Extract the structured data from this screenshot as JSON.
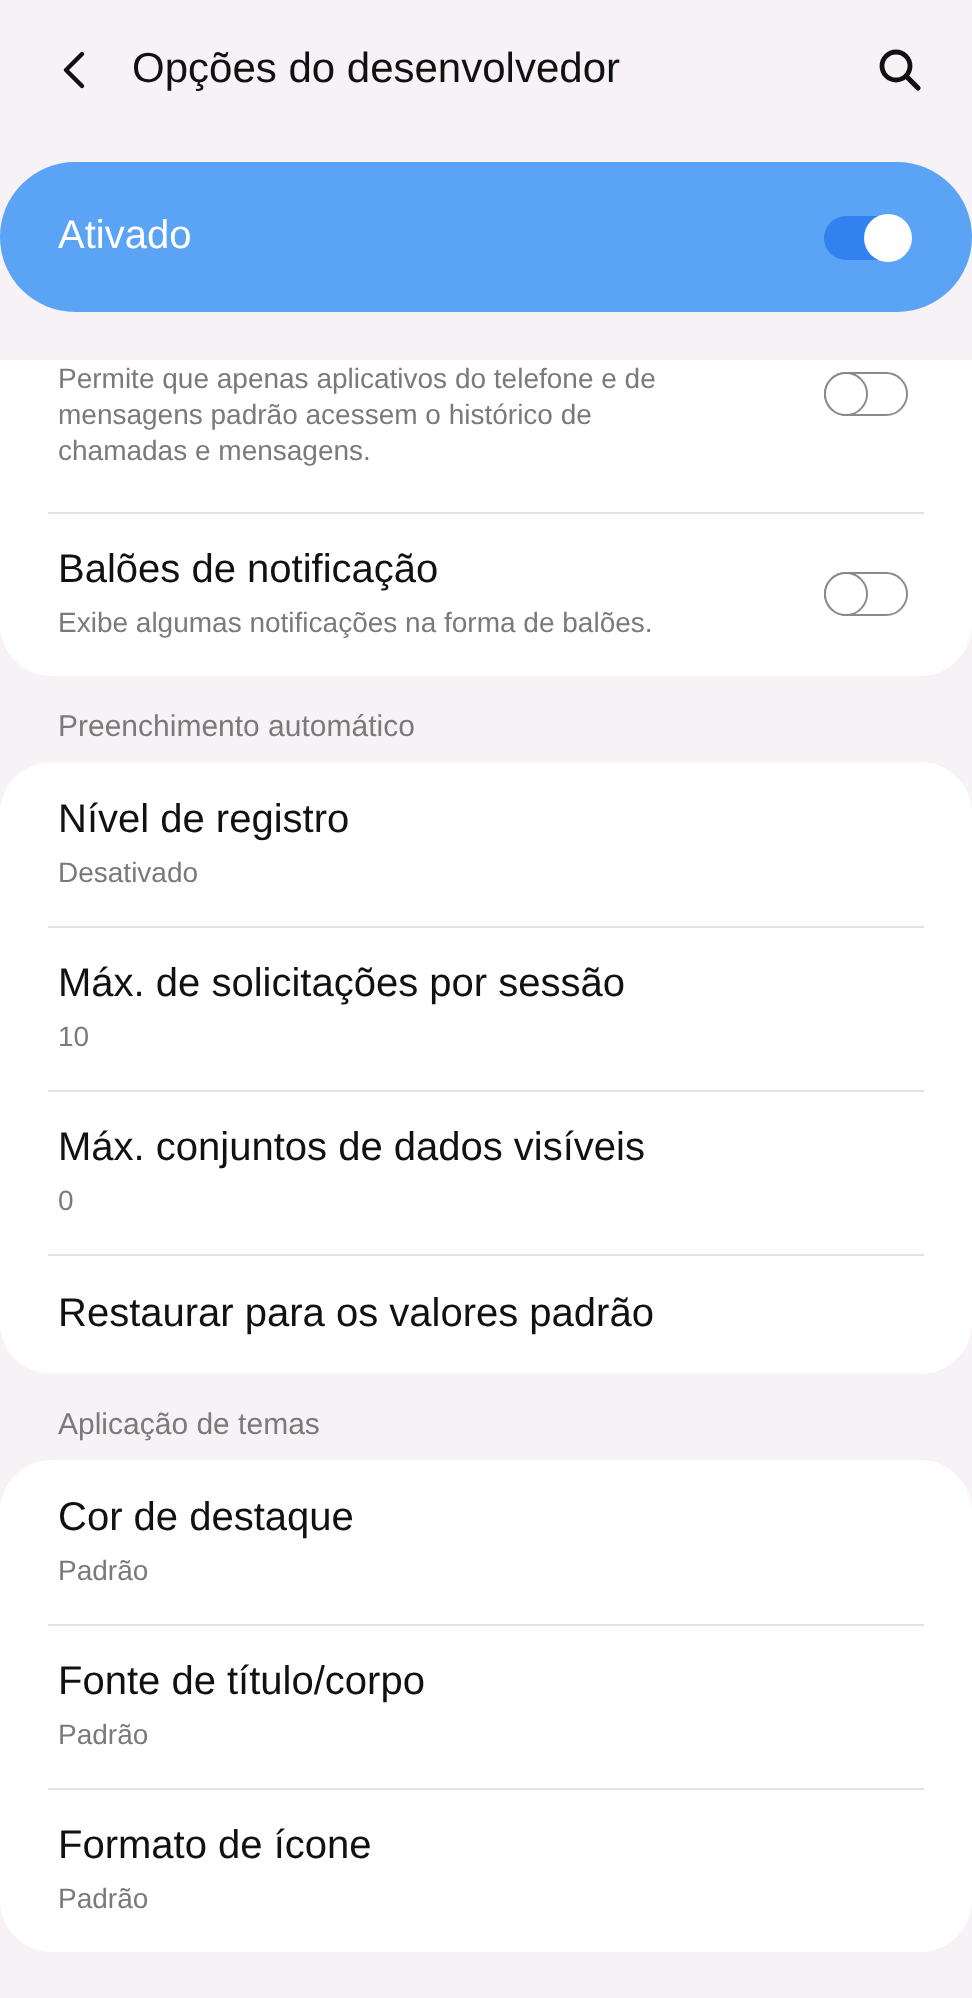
{
  "header": {
    "title": "Opções do desenvolvedor"
  },
  "master": {
    "label": "Ativado",
    "on": true
  },
  "sections": [
    {
      "items": [
        {
          "kind": "switch",
          "summary": "Permite que apenas aplicativos do telefone e de mensagens padrão acessem o histórico de chamadas e mensagens.",
          "on": false
        },
        {
          "kind": "switch",
          "title": "Balões de notificação",
          "summary": "Exibe algumas notificações na forma de balões.",
          "on": false
        }
      ]
    },
    {
      "header": "Preenchimento automático",
      "items": [
        {
          "kind": "text",
          "title": "Nível de registro",
          "summary": "Desativado"
        },
        {
          "kind": "text",
          "title": "Máx. de solicitações por sessão",
          "summary": "10"
        },
        {
          "kind": "text",
          "title": "Máx. conjuntos de dados visíveis",
          "summary": "0"
        },
        {
          "kind": "text",
          "title": "Restaurar para os valores padrão"
        }
      ]
    },
    {
      "header": "Aplicação de temas",
      "items": [
        {
          "kind": "text",
          "title": "Cor de destaque",
          "summary": "Padrão"
        },
        {
          "kind": "text",
          "title": "Fonte de título/corpo",
          "summary": "Padrão"
        },
        {
          "kind": "text",
          "title": "Formato de ícone",
          "summary": "Padrão"
        }
      ]
    }
  ]
}
